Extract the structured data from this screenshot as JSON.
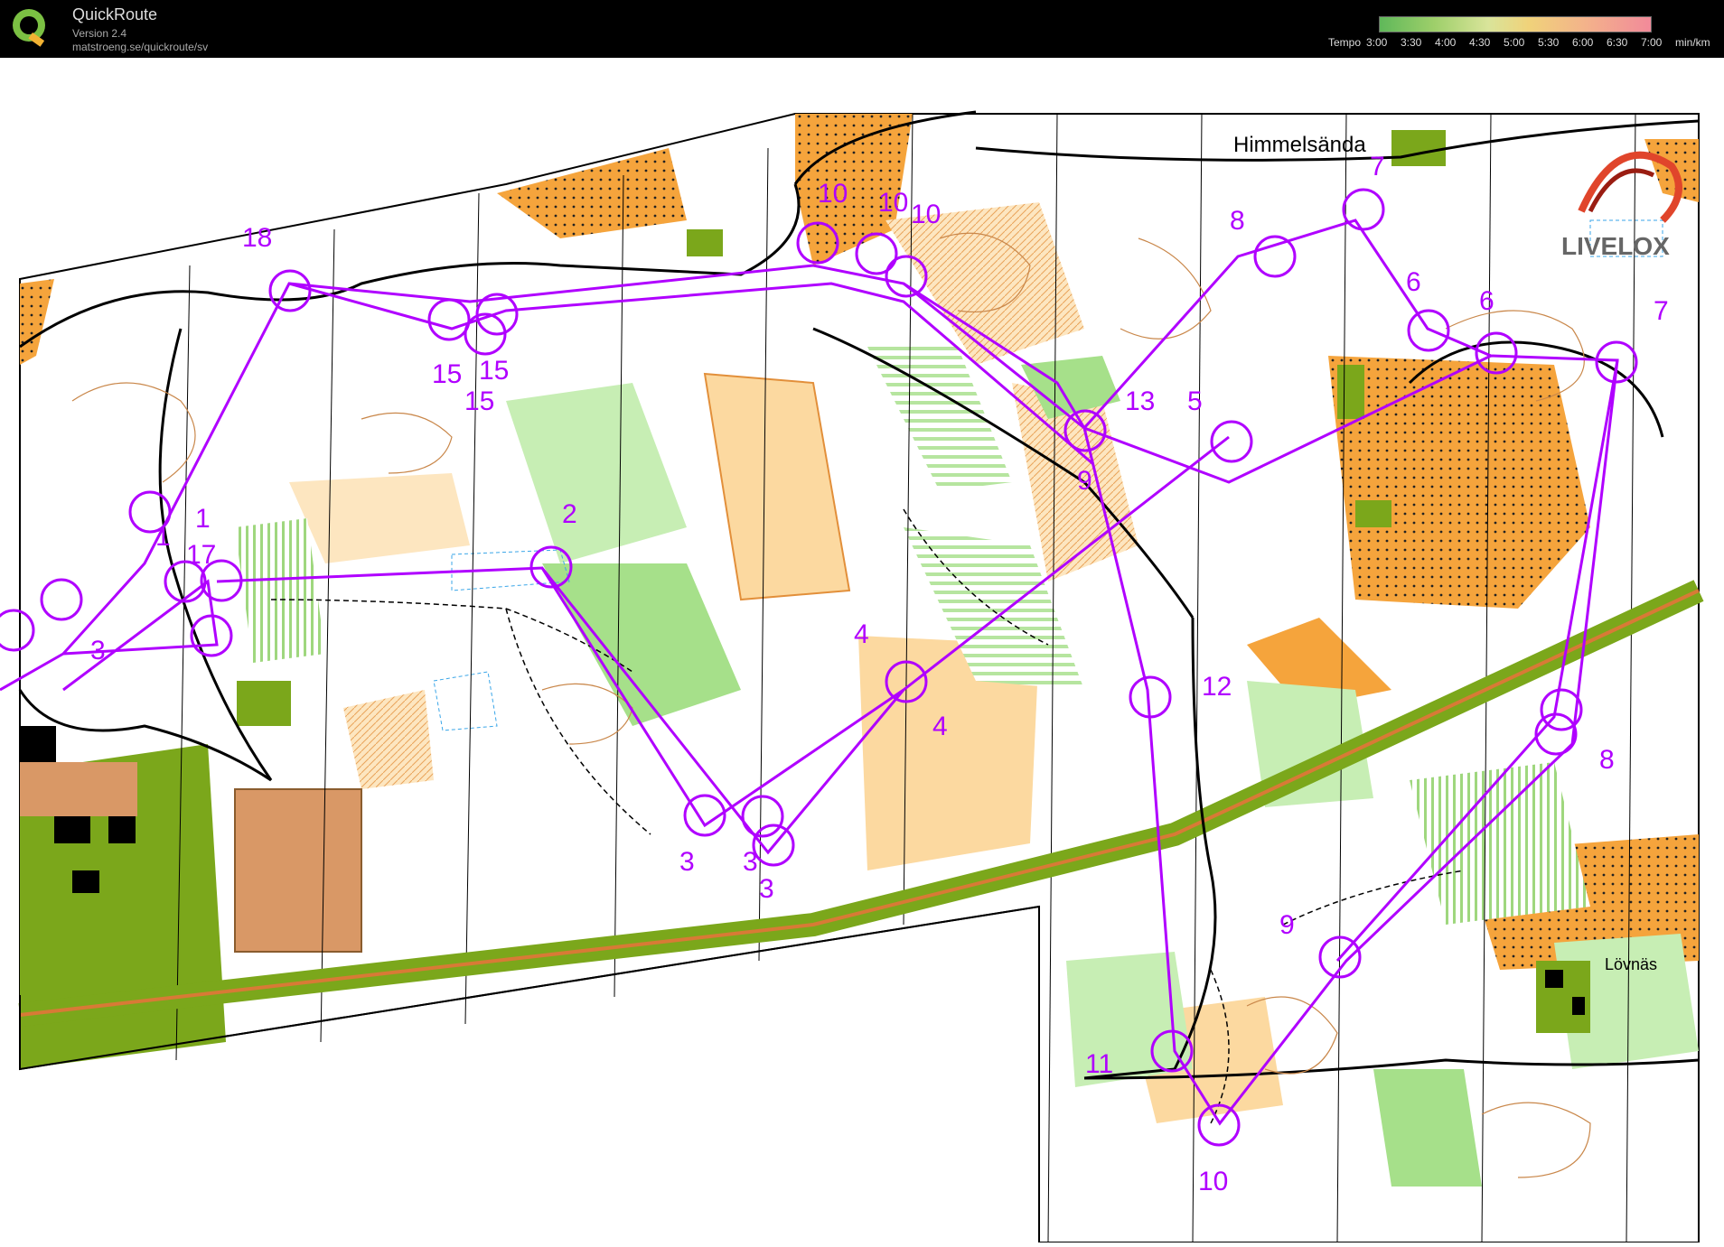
{
  "app": {
    "title": "QuickRoute",
    "version": "Version 2.4",
    "url": "matstroeng.se/quickroute/sv"
  },
  "tempo_legend": {
    "label": "Tempo",
    "ticks": [
      "3:00",
      "3:30",
      "4:00",
      "4:30",
      "5:00",
      "5:30",
      "6:00",
      "6:30",
      "7:00"
    ],
    "unit": "min/km"
  },
  "map": {
    "place_names": [
      "Himmelsända",
      "Lövnäs"
    ],
    "watermark": "LIVELOX",
    "course_color": "#a020f0",
    "route_color": "#b000ff",
    "controls": [
      {
        "label": "1"
      },
      {
        "label": "1"
      },
      {
        "label": "17"
      },
      {
        "label": "18"
      },
      {
        "label": "2"
      },
      {
        "label": "3"
      },
      {
        "label": "3"
      },
      {
        "label": "3"
      },
      {
        "label": "3"
      },
      {
        "label": "4"
      },
      {
        "label": "4"
      },
      {
        "label": "5"
      },
      {
        "label": "6"
      },
      {
        "label": "6"
      },
      {
        "label": "7"
      },
      {
        "label": "7"
      },
      {
        "label": "8"
      },
      {
        "label": "8"
      },
      {
        "label": "9"
      },
      {
        "label": "9"
      },
      {
        "label": "10"
      },
      {
        "label": "10"
      },
      {
        "label": "10"
      },
      {
        "label": "10"
      },
      {
        "label": "11"
      },
      {
        "label": "12"
      },
      {
        "label": "13"
      },
      {
        "label": "15"
      },
      {
        "label": "15"
      },
      {
        "label": "15"
      }
    ]
  }
}
